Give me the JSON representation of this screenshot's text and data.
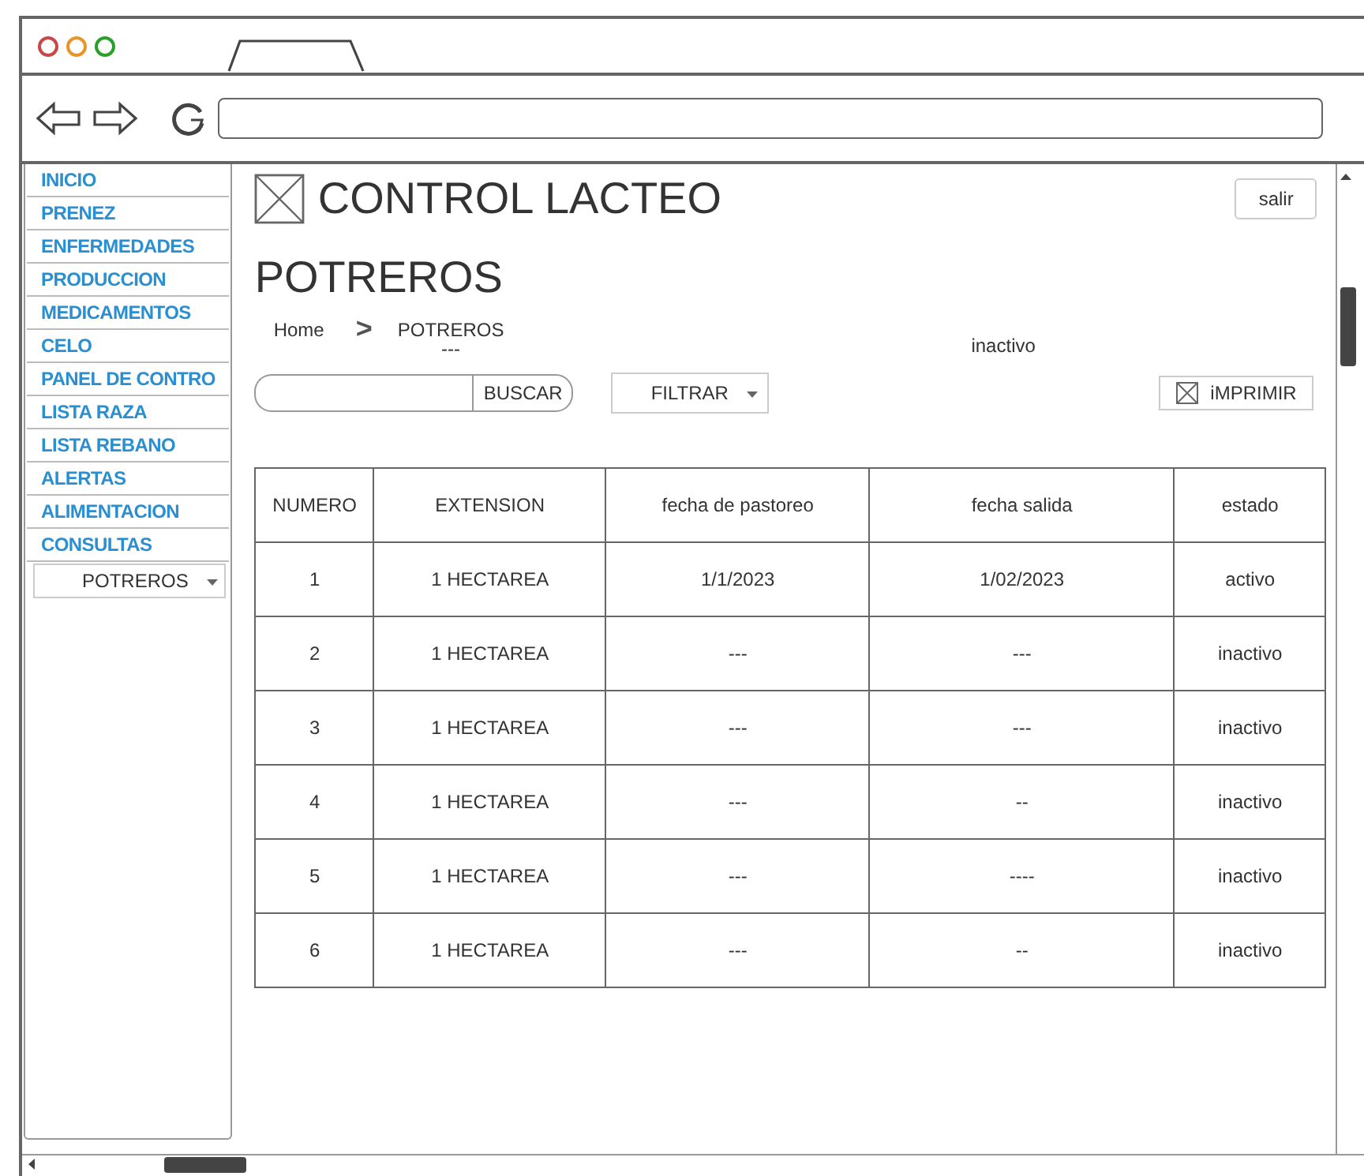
{
  "sidebar": {
    "items": [
      "INICIO",
      "PRENEZ",
      "ENFERMEDADES",
      "PRODUCCION",
      "MEDICAMENTOS",
      "CELO",
      "PANEL DE CONTRO",
      "LISTA RAZA",
      "LISTA REBANO",
      "ALERTAS",
      "ALIMENTACION",
      "CONSULTAS"
    ],
    "dropdown": "POTREROS"
  },
  "header": {
    "title": "CONTROL LACTEO",
    "logout": "salir"
  },
  "page_title": "POTREROS",
  "breadcrumb": {
    "home": "Home",
    "separator": ">",
    "current": "POTREROS"
  },
  "dash_note": "---",
  "floating_text": "inactivo",
  "search": {
    "button": "BUSCAR"
  },
  "filter": "FILTRAR",
  "print": "iMPRIMIR",
  "table": {
    "columns": [
      "NUMERO",
      "EXTENSION",
      "fecha de pastoreo",
      "fecha salida",
      "estado"
    ],
    "rows": [
      [
        "1",
        "1 HECTAREA",
        "1/1/2023",
        "1/02/2023",
        "activo"
      ],
      [
        "2",
        "1 HECTAREA",
        "---",
        "---",
        "inactivo"
      ],
      [
        "3",
        "1 HECTAREA",
        "---",
        "---",
        "inactivo"
      ],
      [
        "4",
        "1 HECTAREA",
        "---",
        "--",
        "inactivo"
      ],
      [
        "5",
        "1 HECTAREA",
        "---",
        "----",
        "inactivo"
      ],
      [
        "6",
        "1 HECTAREA",
        "---",
        "--",
        "inactivo"
      ]
    ]
  }
}
